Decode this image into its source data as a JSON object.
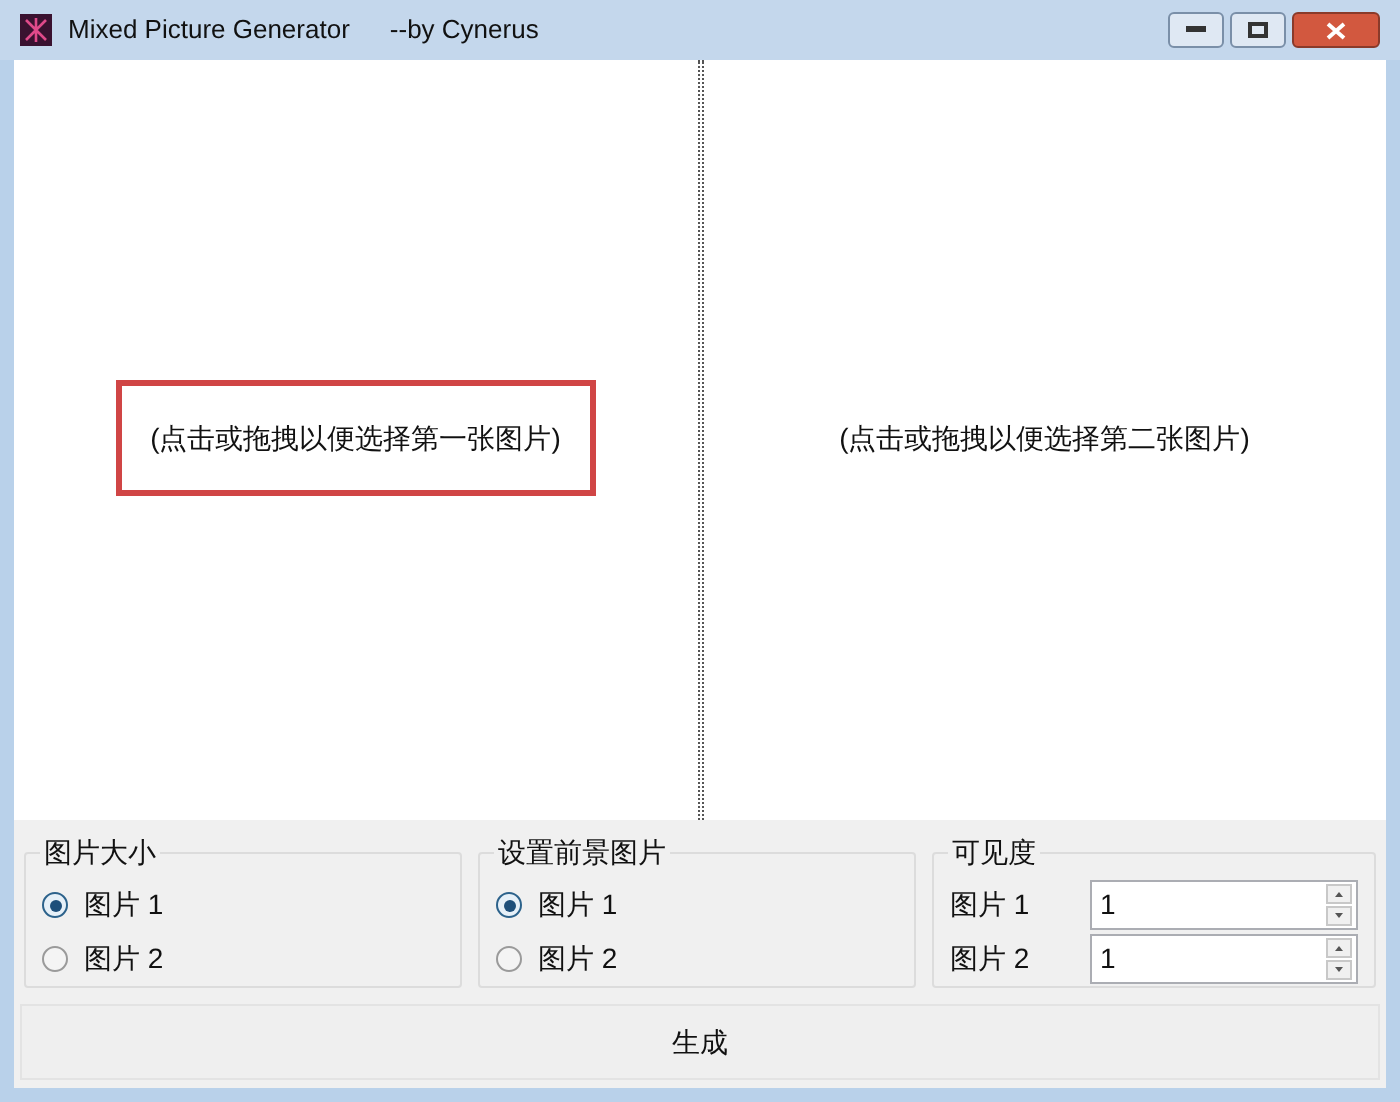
{
  "window": {
    "title": "Mixed Picture Generator",
    "subtitle": "--by Cynerus"
  },
  "panes": [
    {
      "hint": "(点击或拖拽以便选择第一张图片)",
      "highlighted": true
    },
    {
      "hint": "(点击或拖拽以便选择第二张图片)",
      "highlighted": false
    }
  ],
  "groups": [
    {
      "kind": "radio",
      "title": "图片大小",
      "options": [
        {
          "label": "图片 1",
          "selected": true
        },
        {
          "label": "图片 2",
          "selected": false
        }
      ]
    },
    {
      "kind": "radio",
      "title": "设置前景图片",
      "options": [
        {
          "label": "图片 1",
          "selected": true
        },
        {
          "label": "图片 2",
          "selected": false
        }
      ]
    },
    {
      "kind": "spin",
      "title": "可见度",
      "fields": [
        {
          "label": "图片 1",
          "value": "1"
        },
        {
          "label": "图片 2",
          "value": "1"
        }
      ]
    }
  ],
  "generate_button": "生成"
}
